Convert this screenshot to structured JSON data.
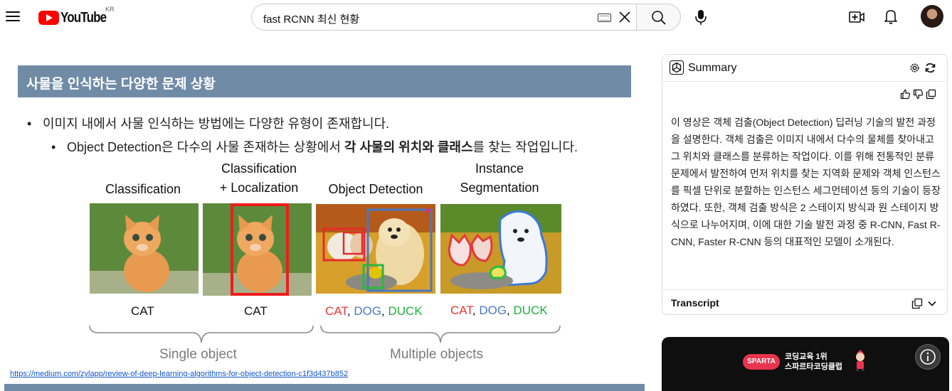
{
  "header": {
    "logo_text": "YouTube",
    "country": "KR",
    "search_query": "fast RCNN 최신 현황"
  },
  "slide": {
    "title": "사물을 인식하는 다양한 문제 상황",
    "bullet1": "이미지 내에서 사물 인식하는 방법에는 다양한 유형이 존재합니다.",
    "bullet2_prefix": "Object Detection",
    "bullet2_middle": "은 다수의 사물 존재하는 상황에서 ",
    "bullet2_bold": "각 사물의 위치와 클래스",
    "bullet2_suffix": "를 찾는 작업입니다.",
    "tasks": [
      {
        "title1": "",
        "title2": "Classification",
        "result": "CAT"
      },
      {
        "title1": "Classification",
        "title2": "+ Localization",
        "result": "CAT"
      },
      {
        "title1": "",
        "title2": "Object Detection"
      },
      {
        "title1": "Instance",
        "title2": "Segmentation"
      }
    ],
    "labels": {
      "cat": "CAT",
      "comma1": ", ",
      "dog": "DOG",
      "comma2": ", ",
      "duck": "DUCK"
    },
    "group_single": "Single object",
    "group_multiple": "Multiple objects",
    "link": "https://medium.com/zylapp/review-of-deep-learning-algorithms-for-object-detection-c1f3d437b852"
  },
  "summary": {
    "title": "Summary",
    "text": "이 영상은 객체 검출(Object Detection) 딥러닝 기술의 발전 과정을 설명한다. 객체 검출은 이미지 내에서 다수의 물체를 찾아내고 그 위치와 클래스를 분류하는 작업이다. 이를 위해 전통적인 분류 문제에서 발전하여 먼저 위치를 찾는 지역화 문제와 객체 인스턴스를 픽셀 단위로 분할하는 인스턴스 세그먼테이션 등의 기술이 등장하였다. 또한, 객체 검출 방식은 2 스테이지 방식과 원 스테이지 방식으로 나누어지며, 이에 대한 기술 발전 과정 중 R-CNN, Fast R-CNN, Faster R-CNN 등의 대표적인 모델이 소개된다.",
    "transcript_label": "Transcript"
  },
  "ad": {
    "badge": "SPARTA",
    "line1": "코딩교육 1위",
    "line2": "스파르타코딩클럽"
  },
  "colors": {
    "slide_header": "#6f8ba6",
    "red": "#e53935",
    "blue": "#4a78c0",
    "green": "#20b040",
    "youtube_red": "#ff0000"
  }
}
